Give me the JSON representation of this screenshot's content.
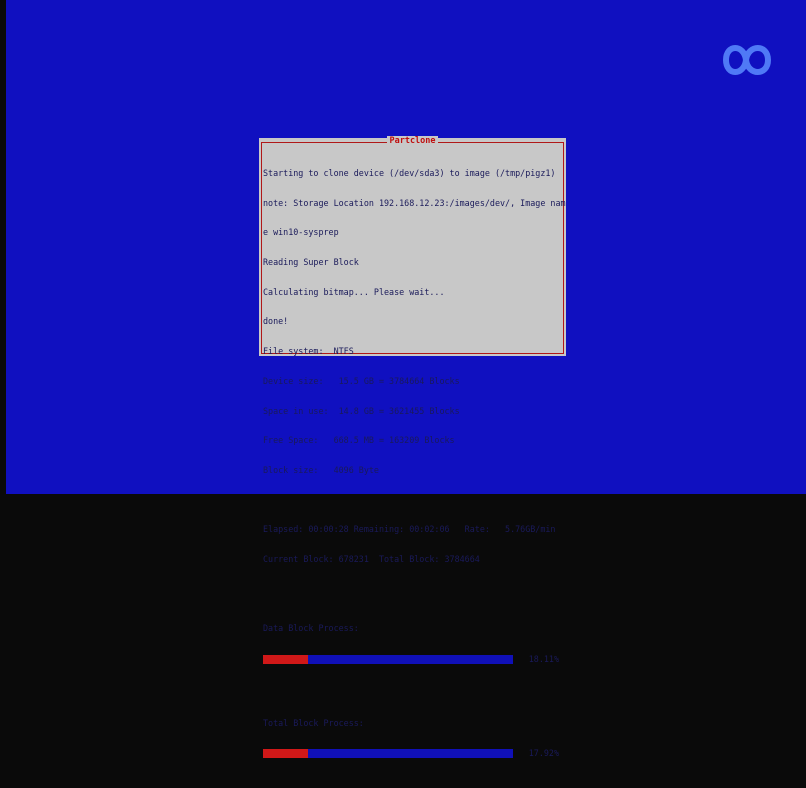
{
  "dialog": {
    "title": "Partclone",
    "lines": [
      "Starting to clone device (/dev/sda3) to image (/tmp/pigz1)",
      "note: Storage Location 192.168.12.23:/images/dev/, Image nam",
      "e win10-sysprep",
      "Reading Super Block",
      "Calculating bitmap... Please wait...",
      "done!",
      "File system:  NTFS",
      "Device size:   15.5 GB = 3784664 Blocks",
      "Space in use:  14.8 GB = 3621455 Blocks",
      "Free Space:   668.5 MB = 163209 Blocks",
      "Block size:   4096 Byte"
    ],
    "status_lines": [
      "Elapsed: 00:00:28 Remaining: 00:02:06   Rate:   5.76GB/min",
      "Current Block: 678231  Total Block: 3784664"
    ],
    "data_block": {
      "label": "Data Block Process:",
      "percent_text": "18.11%",
      "fraction": 0.1811
    },
    "total_block": {
      "label": "Total Block Process:",
      "percent_text": "17.92%",
      "fraction": 0.1792
    }
  },
  "colors": {
    "screen_bg": "#1010c0",
    "dialog_bg": "#c8c8c8",
    "accent_red": "#c01010",
    "bar_track": "#1010b8",
    "bar_fill": "#d01818"
  },
  "watermark": {
    "icon": "infinity-cloud-icon"
  }
}
